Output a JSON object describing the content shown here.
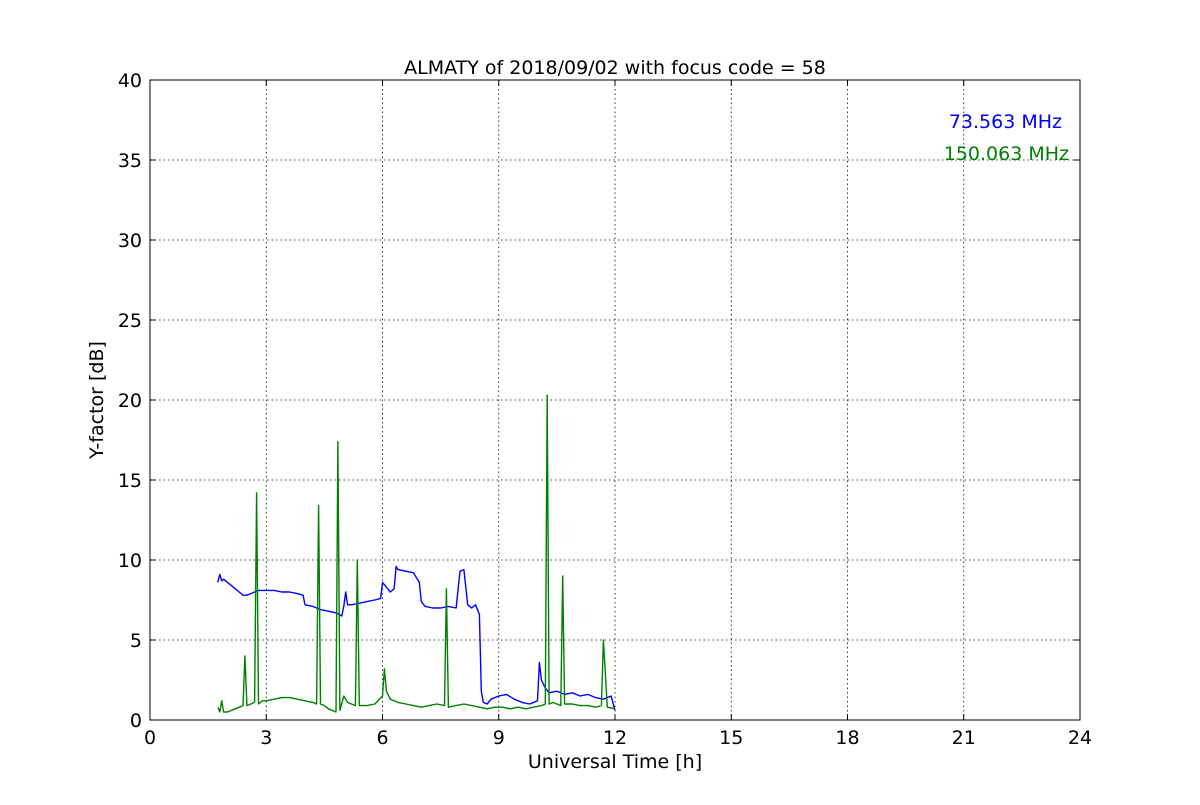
{
  "chart_data": {
    "type": "line",
    "title": "ALMATY of 2018/09/02 with focus code = 58",
    "xlabel": "Universal Time [h]",
    "ylabel": "Y-factor [dB]",
    "xlim": [
      0,
      24
    ],
    "ylim": [
      0,
      40
    ],
    "xticks": [
      0,
      3,
      6,
      9,
      12,
      15,
      18,
      21,
      24
    ],
    "yticks": [
      0,
      5,
      10,
      15,
      20,
      25,
      30,
      35,
      40
    ],
    "xtick_labels": [
      "0",
      "3",
      "6",
      "9",
      "12",
      "15",
      "18",
      "21",
      "24"
    ],
    "ytick_labels": [
      "0",
      "5",
      "10",
      "15",
      "20",
      "25",
      "30",
      "35",
      "40"
    ],
    "grid": true,
    "legend_position": "top-right",
    "series": [
      {
        "name": "73.563 MHz",
        "color": "#0000ff",
        "x": [
          1.75,
          1.8,
          1.85,
          1.9,
          2.0,
          2.1,
          2.2,
          2.3,
          2.4,
          2.5,
          2.6,
          2.7,
          2.8,
          3.0,
          3.2,
          3.4,
          3.6,
          3.8,
          3.95,
          4.0,
          4.2,
          4.4,
          4.6,
          4.8,
          4.95,
          5.0,
          5.05,
          5.1,
          5.2,
          5.4,
          5.6,
          5.8,
          5.95,
          6.0,
          6.1,
          6.2,
          6.3,
          6.35,
          6.4,
          6.6,
          6.8,
          6.95,
          7.0,
          7.1,
          7.3,
          7.5,
          7.7,
          7.9,
          8.0,
          8.1,
          8.2,
          8.25,
          8.3,
          8.4,
          8.5,
          8.55,
          8.6,
          8.7,
          8.8,
          9.0,
          9.2,
          9.4,
          9.6,
          9.8,
          10.0,
          10.05,
          10.1,
          10.2,
          10.3,
          10.5,
          10.7,
          10.9,
          11.1,
          11.3,
          11.5,
          11.7,
          11.9,
          12.0
        ],
        "y": [
          8.6,
          9.1,
          8.7,
          8.8,
          8.6,
          8.4,
          8.2,
          8.0,
          7.8,
          7.8,
          7.9,
          8.0,
          8.1,
          8.1,
          8.1,
          8.0,
          8.0,
          7.9,
          7.8,
          7.2,
          7.1,
          6.9,
          6.8,
          6.7,
          6.5,
          7.1,
          8.0,
          7.2,
          7.2,
          7.3,
          7.4,
          7.5,
          7.6,
          8.6,
          8.3,
          8.0,
          8.2,
          9.6,
          9.4,
          9.3,
          9.2,
          8.6,
          7.4,
          7.1,
          7.0,
          7.0,
          7.1,
          7.0,
          9.3,
          9.4,
          7.2,
          7.1,
          7.0,
          7.2,
          6.6,
          1.8,
          1.1,
          1.0,
          1.3,
          1.5,
          1.6,
          1.3,
          1.1,
          1.0,
          1.2,
          3.6,
          2.5,
          2.0,
          1.7,
          1.8,
          1.6,
          1.7,
          1.5,
          1.6,
          1.4,
          1.3,
          1.5,
          0.6
        ]
      },
      {
        "name": "150.063 MHz",
        "color": "#008000",
        "x": [
          1.75,
          1.8,
          1.85,
          1.9,
          2.0,
          2.2,
          2.4,
          2.45,
          2.5,
          2.6,
          2.7,
          2.75,
          2.8,
          2.9,
          3.0,
          3.2,
          3.4,
          3.6,
          3.8,
          4.0,
          4.2,
          4.3,
          4.35,
          4.4,
          4.5,
          4.6,
          4.8,
          4.85,
          4.9,
          5.0,
          5.1,
          5.2,
          5.3,
          5.35,
          5.4,
          5.6,
          5.8,
          6.0,
          6.05,
          6.1,
          6.2,
          6.4,
          6.6,
          6.8,
          7.0,
          7.2,
          7.4,
          7.6,
          7.65,
          7.7,
          7.9,
          8.1,
          8.3,
          8.5,
          8.7,
          8.9,
          9.1,
          9.3,
          9.5,
          9.7,
          9.9,
          10.1,
          10.2,
          10.25,
          10.3,
          10.4,
          10.5,
          10.6,
          10.65,
          10.7,
          10.9,
          11.1,
          11.3,
          11.5,
          11.65,
          11.7,
          11.8,
          12.0
        ],
        "y": [
          0.8,
          0.5,
          1.2,
          0.5,
          0.5,
          0.7,
          0.9,
          4.0,
          0.9,
          1.0,
          1.1,
          14.2,
          1.0,
          1.2,
          1.2,
          1.3,
          1.4,
          1.4,
          1.3,
          1.2,
          1.1,
          1.0,
          13.4,
          1.0,
          0.9,
          0.7,
          0.5,
          17.4,
          0.6,
          1.5,
          1.1,
          1.0,
          0.9,
          10.0,
          0.9,
          0.9,
          1.0,
          1.5,
          3.2,
          1.8,
          1.3,
          1.1,
          1.0,
          0.9,
          0.8,
          0.9,
          1.0,
          0.9,
          8.2,
          0.8,
          0.9,
          1.0,
          0.9,
          0.8,
          0.7,
          0.8,
          0.8,
          0.7,
          0.8,
          0.7,
          0.8,
          0.9,
          1.0,
          20.3,
          1.0,
          1.1,
          1.0,
          0.9,
          9.0,
          1.0,
          1.0,
          0.9,
          0.9,
          0.8,
          0.9,
          5.0,
          0.8,
          0.7
        ]
      }
    ]
  }
}
